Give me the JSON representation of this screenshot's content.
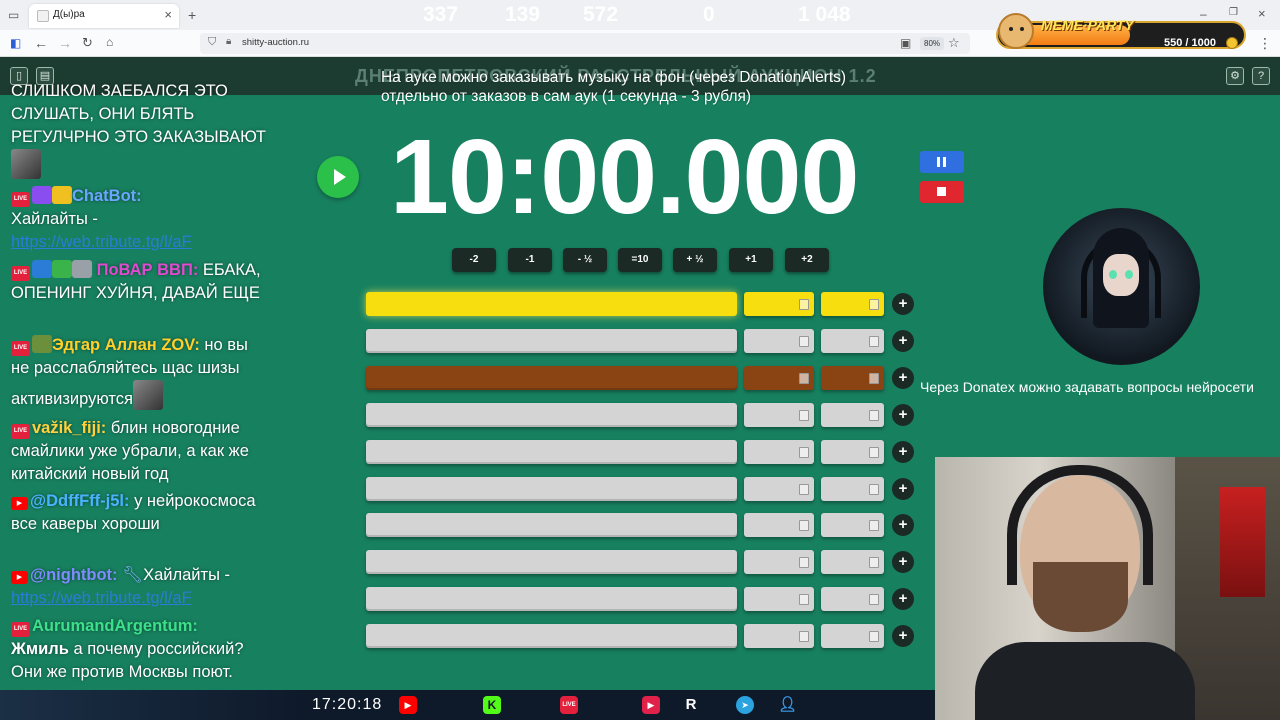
{
  "browser": {
    "tab_title": "Д(ы)ра",
    "url": "shitty-auction.ru",
    "zoom": "80%"
  },
  "meme_party": {
    "brand": "MEME·PARTY",
    "count": "550 / 1000"
  },
  "header": {
    "ghost_title": "ДНЕПРОПЕТРОВСКИЙ РАССТРЕЛЬНЫЙ АУКЦИОН 1.2",
    "notice_line1": "На ауке можно заказывать музыку на фон (через DonationAlerts)",
    "notice_line2": "отдельно от заказов в сам аук (1 секунда - 3 рубля)"
  },
  "chat": [
    {
      "id": "m0",
      "text": "СЛИШКОМ ЗАЕБАЛСЯ ЭТО СЛУШАТЬ, ОНИ БЛЯТЬ РЕГУЛЧРНО ЭТО ЗАКАЗЫВАЮТ"
    },
    {
      "id": "m1",
      "user": "ChatBot:",
      "text": "Хайлайты -",
      "link": "https://web.tribute.tg/l/aF"
    },
    {
      "id": "m2",
      "user": "ПоВАР ВВП:",
      "text": "ЕБАКА, ОПЕНИНГ ХУЙНЯ, ДАВАЙ ЕЩЕ"
    },
    {
      "id": "m3",
      "user": "Эдгар Аллан ZOV:",
      "text": "но вы не расслабляйтесь щас шизы активизируются"
    },
    {
      "id": "m4",
      "user": "važik_fiji:",
      "text": "блин новогодние смайлики уже убрали, а как же китайский новый год"
    },
    {
      "id": "m5",
      "user": "@DdffFff-j5l:",
      "text": "у нейрокосмоса все каверы хороши"
    },
    {
      "id": "m6",
      "user": "@nightbot:",
      "text": "Хайлайты -",
      "link": "https://web.tribute.tg/l/aF"
    },
    {
      "id": "m7",
      "user": "AurumandArgentum:",
      "bold": "Жмиль",
      "text": "а почему российский? Они же против Москвы поют."
    }
  ],
  "live_badge": "LIVE",
  "timer": "10:00.000",
  "adjust_buttons": [
    "-2",
    "-1",
    "- ½",
    "=10",
    "+ ½",
    "+1",
    "+2"
  ],
  "lots": [
    {
      "style": "gold"
    },
    {
      "style": "grey"
    },
    {
      "style": "brown"
    },
    {
      "style": "grey"
    },
    {
      "style": "grey"
    },
    {
      "style": "grey"
    },
    {
      "style": "grey"
    },
    {
      "style": "grey"
    },
    {
      "style": "grey"
    },
    {
      "style": "grey"
    }
  ],
  "plus_label": "+",
  "donatex_text": "Через Donatex можно задавать вопросы нейросети",
  "stats": {
    "clock": "17:20:18",
    "youtube": "337",
    "kick": "139",
    "live": "572",
    "other": "",
    "rumble": "0",
    "telegram": "",
    "viewers": "1 048"
  }
}
